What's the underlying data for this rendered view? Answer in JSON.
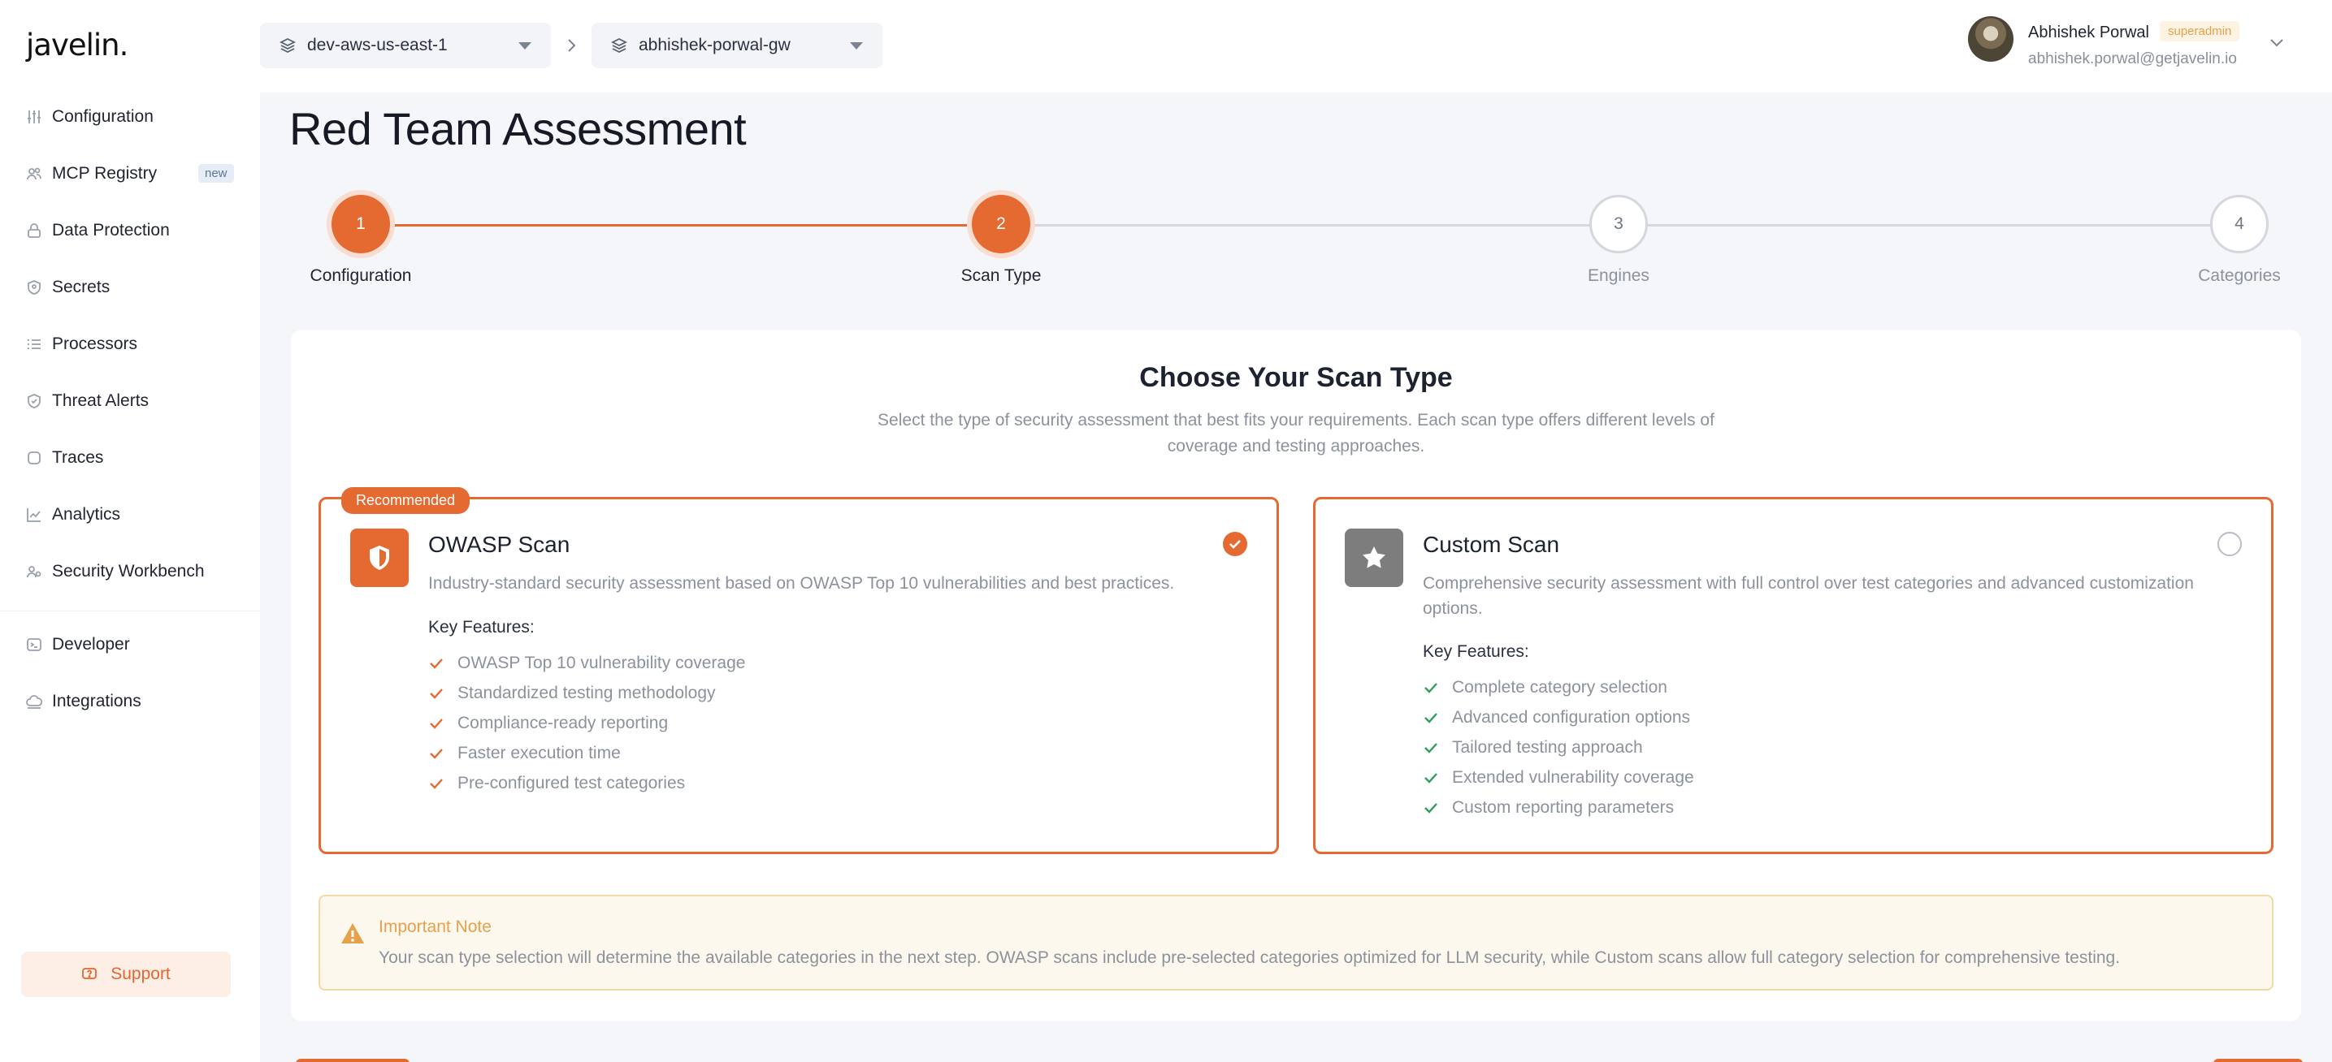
{
  "app": {
    "logo": "javelin."
  },
  "sidebar": {
    "items": [
      {
        "label": "Configuration",
        "icon": "sliders-icon"
      },
      {
        "label": "MCP Registry",
        "icon": "users-icon",
        "badge": "new"
      },
      {
        "label": "Data Protection",
        "icon": "lock-icon"
      },
      {
        "label": "Secrets",
        "icon": "shield-key-icon"
      },
      {
        "label": "Processors",
        "icon": "list-icon"
      },
      {
        "label": "Threat Alerts",
        "icon": "shield-check-icon"
      },
      {
        "label": "Traces",
        "icon": "square-icon"
      },
      {
        "label": "Analytics",
        "icon": "chart-line-icon"
      },
      {
        "label": "Security Workbench",
        "icon": "users-gear-icon"
      },
      {
        "label": "Developer",
        "icon": "terminal-icon"
      },
      {
        "label": "Integrations",
        "icon": "cloud-icon"
      }
    ],
    "support_label": "Support"
  },
  "header": {
    "environment": "dev-aws-us-east-1",
    "gateway": "abhishek-porwal-gw",
    "user": {
      "name": "Abhishek Porwal",
      "role": "superadmin",
      "email": "abhishek.porwal@getjavelin.io"
    }
  },
  "page": {
    "title": "Red Team Assessment"
  },
  "stepper": {
    "steps": [
      {
        "number": "1",
        "label": "Configuration",
        "state": "complete"
      },
      {
        "number": "2",
        "label": "Scan Type",
        "state": "active"
      },
      {
        "number": "3",
        "label": "Engines",
        "state": "pending"
      },
      {
        "number": "4",
        "label": "Categories",
        "state": "pending"
      }
    ]
  },
  "scan_type": {
    "heading": "Choose Your Scan Type",
    "subheading": "Select the type of security assessment that best fits your requirements. Each scan type offers different levels of coverage and testing approaches.",
    "options": [
      {
        "title": "OWASP Scan",
        "badge": "Recommended",
        "selected": true,
        "description": "Industry-standard security assessment based on OWASP Top 10 vulnerabilities and best practices.",
        "features_title": "Key Features:",
        "features": [
          "OWASP Top 10 vulnerability coverage",
          "Standardized testing methodology",
          "Compliance-ready reporting",
          "Faster execution time",
          "Pre-configured test categories"
        ]
      },
      {
        "title": "Custom Scan",
        "selected": false,
        "description": "Comprehensive security assessment with full control over test categories and advanced customization options.",
        "features_title": "Key Features:",
        "features": [
          "Complete category selection",
          "Advanced configuration options",
          "Tailored testing approach",
          "Extended vulnerability coverage",
          "Custom reporting parameters"
        ]
      }
    ]
  },
  "note": {
    "title": "Important Note",
    "text": "Your scan type selection will determine the available categories in the next step. OWASP scans include pre-selected categories optimized for LLM security, while Custom scans allow full category selection for comprehensive testing."
  },
  "colors": {
    "accent": "#e56a32",
    "success": "#2f9e5a",
    "warning": "#e6a14b"
  }
}
